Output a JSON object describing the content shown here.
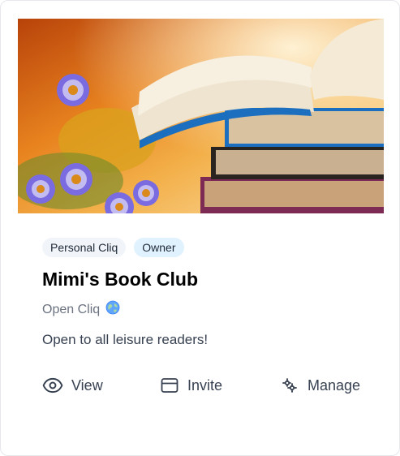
{
  "card": {
    "badges": [
      "Personal Cliq",
      "Owner"
    ],
    "title": "Mimi's Book Club",
    "visibility": {
      "label": "Open Cliq",
      "icon": "globe-icon"
    },
    "description": "Open to all leisure readers!",
    "actions": {
      "view": {
        "label": "View",
        "icon": "eye-icon"
      },
      "invite": {
        "label": "Invite",
        "icon": "card-icon"
      },
      "manage": {
        "label": "Manage",
        "icon": "settings-icon"
      }
    }
  },
  "colors": {
    "badge_personal_bg": "#f1f5f9",
    "badge_owner_bg": "#e0f2fe",
    "title": "#000000",
    "muted_text": "#6b7280",
    "body_text": "#374151"
  }
}
